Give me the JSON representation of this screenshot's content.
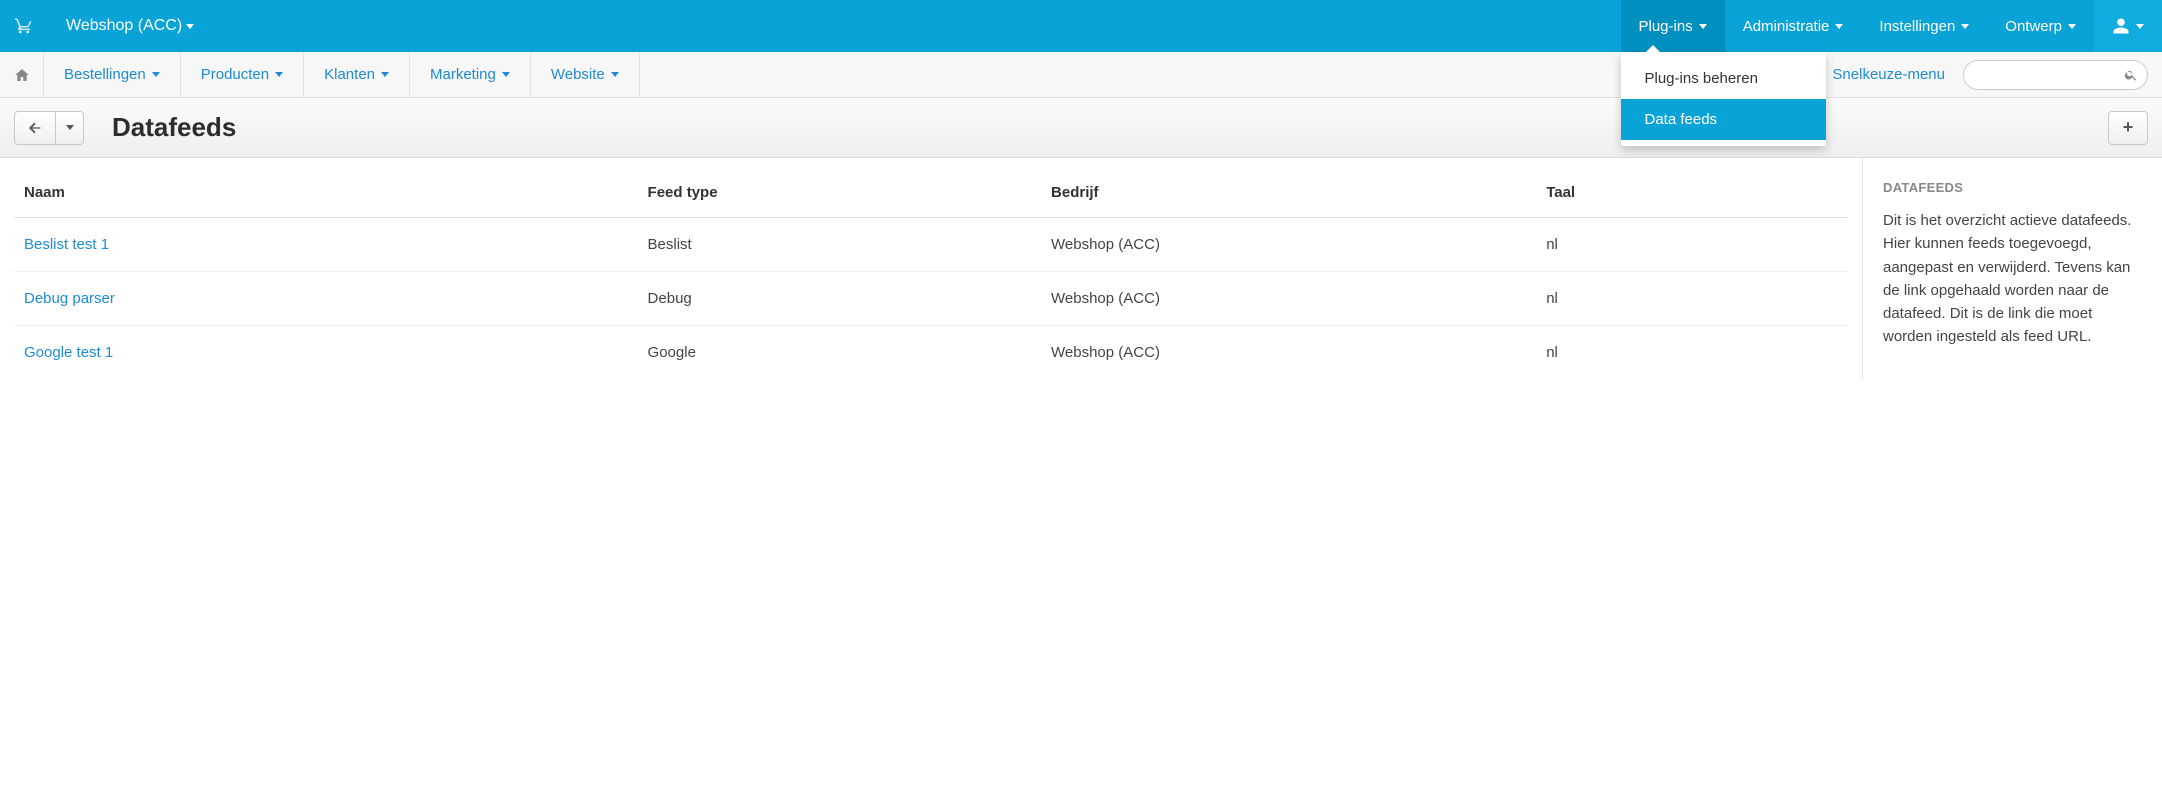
{
  "topbar": {
    "shop_name": "Webshop (ACC)",
    "items": [
      {
        "label": "Plug-ins",
        "active": true
      },
      {
        "label": "Administratie",
        "active": false
      },
      {
        "label": "Instellingen",
        "active": false
      },
      {
        "label": "Ontwerp",
        "active": false
      }
    ],
    "dropdown": {
      "items": [
        {
          "label": "Plug-ins beheren",
          "active": false
        },
        {
          "label": "Data feeds",
          "active": true
        }
      ]
    }
  },
  "secnav": {
    "items": [
      {
        "label": "Bestellingen"
      },
      {
        "label": "Producten"
      },
      {
        "label": "Klanten"
      },
      {
        "label": "Marketing"
      },
      {
        "label": "Website"
      }
    ],
    "quick_label": "Snelkeuze-menu",
    "search_placeholder": ""
  },
  "page": {
    "title": "Datafeeds"
  },
  "table": {
    "headers": {
      "name": "Naam",
      "type": "Feed type",
      "company": "Bedrijf",
      "lang": "Taal"
    },
    "rows": [
      {
        "name": "Beslist test 1",
        "type": "Beslist",
        "company": "Webshop (ACC)",
        "lang": "nl"
      },
      {
        "name": "Debug parser",
        "type": "Debug",
        "company": "Webshop (ACC)",
        "lang": "nl"
      },
      {
        "name": "Google test 1",
        "type": "Google",
        "company": "Webshop (ACC)",
        "lang": "nl"
      }
    ]
  },
  "sidebar": {
    "heading": "DATAFEEDS",
    "text": "Dit is het overzicht actieve datafeeds. Hier kunnen feeds toegevoegd, aangepast en verwijderd. Tevens kan de link opgehaald worden naar de datafeed. Dit is de link die moet worden ingesteld als feed URL."
  }
}
